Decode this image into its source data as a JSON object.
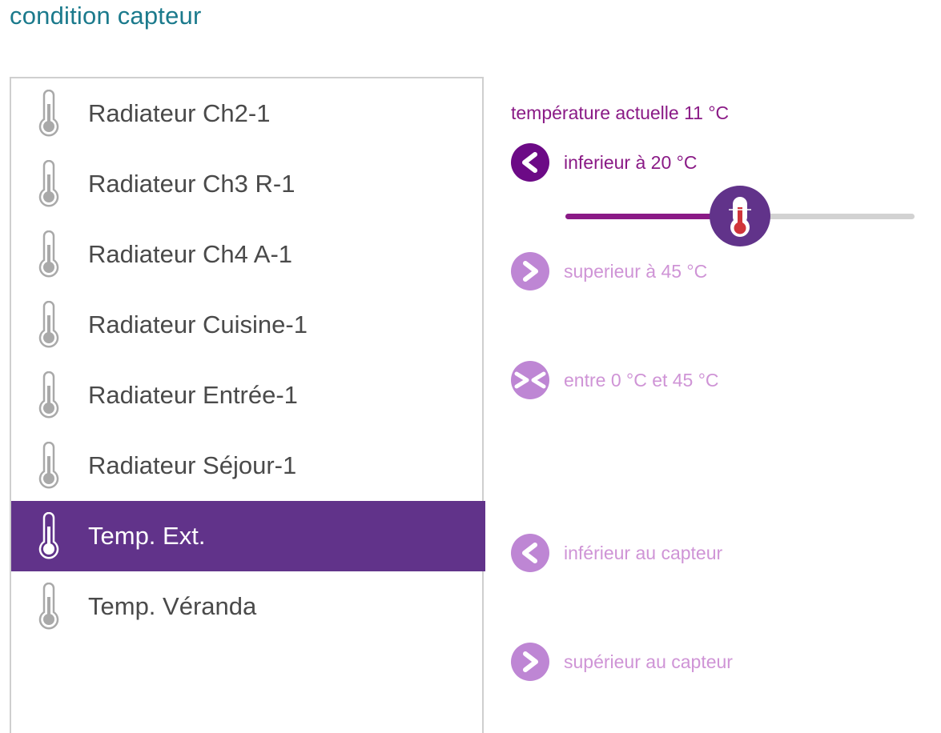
{
  "page": {
    "title": "condition capteur"
  },
  "colors": {
    "title": "#1b7a8c",
    "selected_row": "#61338a",
    "accent_dark": "#6c0a86",
    "accent_light": "#be86d4",
    "text_active": "#8a1a86",
    "text_inactive": "#cf94d6"
  },
  "sensors": {
    "items": [
      {
        "label": "Radiateur Ch2-1",
        "icon": "thermometer-icon",
        "selected": false
      },
      {
        "label": "Radiateur Ch3 R-1",
        "icon": "thermometer-icon",
        "selected": false
      },
      {
        "label": "Radiateur Ch4 A-1",
        "icon": "thermometer-icon",
        "selected": false
      },
      {
        "label": "Radiateur Cuisine-1",
        "icon": "thermometer-icon",
        "selected": false
      },
      {
        "label": "Radiateur Entrée-1",
        "icon": "thermometer-icon",
        "selected": false
      },
      {
        "label": "Radiateur Séjour-1",
        "icon": "thermometer-icon",
        "selected": false
      },
      {
        "label": "Temp. Ext.",
        "icon": "thermometer-icon",
        "selected": true
      },
      {
        "label": "Temp. Véranda",
        "icon": "thermometer-icon",
        "selected": false
      }
    ]
  },
  "condition": {
    "current_temperature": "température actuelle 11 °C",
    "options": [
      {
        "label": "inferieur à 20 °C",
        "icon": "less-than-icon",
        "active": true
      },
      {
        "label": "superieur à 45 °C",
        "icon": "greater-than-icon",
        "active": false
      },
      {
        "label": "entre 0 °C et 45 °C",
        "icon": "between-icon",
        "active": false
      },
      {
        "label": "inférieur au capteur",
        "icon": "less-than-icon",
        "active": false
      },
      {
        "label": "supérieur au capteur",
        "icon": "greater-than-icon",
        "active": false
      }
    ],
    "slider": {
      "fraction": 0.5,
      "thumb_icon": "thermometer-icon"
    }
  }
}
